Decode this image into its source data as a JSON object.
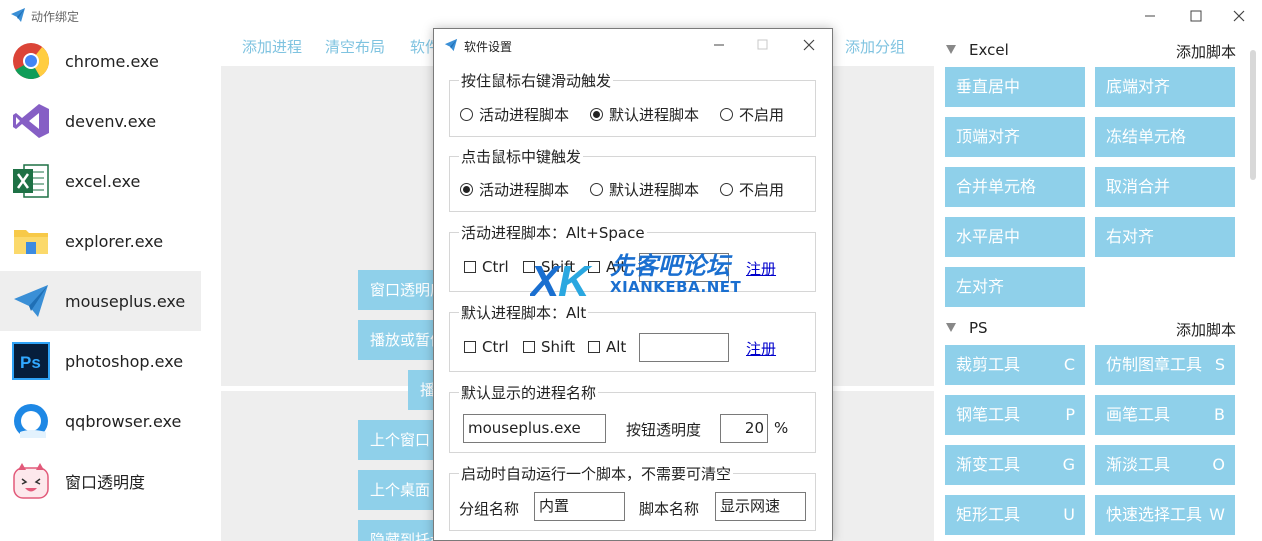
{
  "window": {
    "title": "动作绑定"
  },
  "processes": [
    {
      "label": "chrome.exe",
      "icon": "chrome-icon"
    },
    {
      "label": "devenv.exe",
      "icon": "visual-studio-icon"
    },
    {
      "label": "excel.exe",
      "icon": "excel-icon"
    },
    {
      "label": "explorer.exe",
      "icon": "folder-icon"
    },
    {
      "label": "mouseplus.exe",
      "icon": "paper-plane-icon",
      "selected": true
    },
    {
      "label": "photoshop.exe",
      "icon": "photoshop-icon"
    },
    {
      "label": "qqbrowser.exe",
      "icon": "qqbrowser-icon"
    },
    {
      "label": "窗口透明度",
      "icon": "cartoon-face-icon"
    }
  ],
  "toolbar": {
    "add_process": "添加进程",
    "clear_layout": "清空布局",
    "software_settings": "软件设置",
    "add_group": "添加分组"
  },
  "mid_buttons": {
    "window_transparency": "窗口透明度",
    "play_pause": "播放或暂停",
    "play": "播放",
    "prev_window": "上个窗口",
    "prev_desktop": "上个桌面",
    "hide_to_tray": "隐藏到托盘"
  },
  "groups": [
    {
      "name": "Excel",
      "add_label": "添加脚本",
      "scripts": [
        {
          "label": "垂直居中",
          "key": ""
        },
        {
          "label": "底端对齐",
          "key": ""
        },
        {
          "label": "顶端对齐",
          "key": ""
        },
        {
          "label": "冻结单元格",
          "key": ""
        },
        {
          "label": "合并单元格",
          "key": ""
        },
        {
          "label": "取消合并",
          "key": ""
        },
        {
          "label": "水平居中",
          "key": ""
        },
        {
          "label": "右对齐",
          "key": ""
        },
        {
          "label": "左对齐",
          "key": ""
        }
      ]
    },
    {
      "name": "PS",
      "add_label": "添加脚本",
      "scripts": [
        {
          "label": "裁剪工具",
          "key": "C"
        },
        {
          "label": "仿制图章工具",
          "key": "S"
        },
        {
          "label": "钢笔工具",
          "key": "P"
        },
        {
          "label": "画笔工具",
          "key": "B"
        },
        {
          "label": "渐变工具",
          "key": "G"
        },
        {
          "label": "渐淡工具",
          "key": "O"
        },
        {
          "label": "矩形工具",
          "key": "U"
        },
        {
          "label": "快速选择工具",
          "key": "W"
        }
      ]
    }
  ],
  "dialog": {
    "title": "软件设置",
    "right_drag": {
      "legend": "按住鼠标右键滑动触发",
      "options": [
        "活动进程脚本",
        "默认进程脚本",
        "不启用"
      ],
      "selected_index": 1
    },
    "middle_click": {
      "legend": "点击鼠标中键触发",
      "options": [
        "活动进程脚本",
        "默认进程脚本",
        "不启用"
      ],
      "selected_index": 0
    },
    "active_hotkey": {
      "legend": "活动进程脚本：Alt+Space",
      "ctrl": "Ctrl",
      "shift": "Shift",
      "alt": "Alt",
      "value": "",
      "register": "注册"
    },
    "default_hotkey": {
      "legend": "默认进程脚本：Alt",
      "ctrl": "Ctrl",
      "shift": "Shift",
      "alt": "Alt",
      "value": "",
      "register": "注册"
    },
    "default_process": {
      "legend": "默认显示的进程名称",
      "value": "mouseplus.exe",
      "opacity_label": "按钮透明度",
      "opacity_value": "20",
      "percent": "%"
    },
    "startup": {
      "legend": "启动时自动运行一个脚本，不需要可清空",
      "group_label": "分组名称",
      "group_value": "内置",
      "script_label": "脚本名称",
      "script_value": "显示网速"
    }
  },
  "watermark": {
    "title": "先客吧论坛",
    "url": "XIANKEBA.NET"
  },
  "colors": {
    "accent": "#8fd0ea",
    "link": "#7fc3e0"
  }
}
